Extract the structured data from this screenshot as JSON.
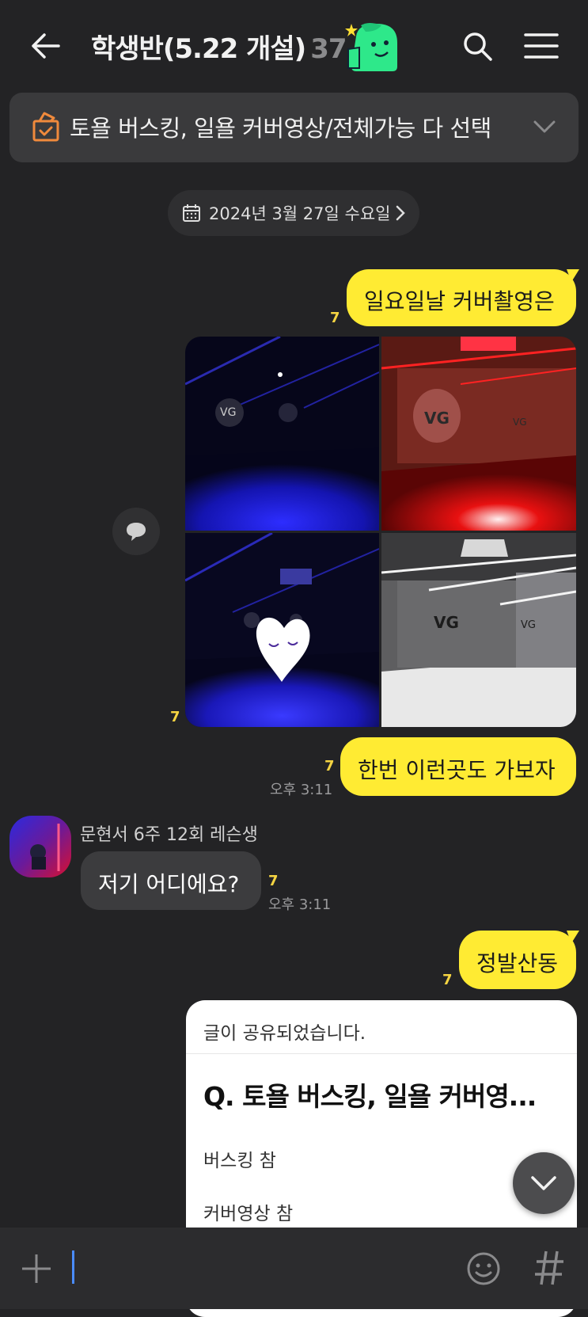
{
  "header": {
    "title": "학생반(5.22 개설)",
    "member_count": "37",
    "icons": [
      "back-arrow-icon",
      "search-icon",
      "menu-icon"
    ]
  },
  "notice": {
    "text": "토욜 버스킹, 일욜 커버영상/전체가능 다 선택"
  },
  "date_divider": "2024년 3월 27일 수요일",
  "messages": [
    {
      "from": "me",
      "text": "일요일날 커버촬영은",
      "unread": "7"
    },
    {
      "from": "me",
      "type": "photos",
      "unread": "7"
    },
    {
      "from": "me",
      "text": "한번 이런곳도 가보자",
      "unread": "7",
      "time": "오후 3:11"
    },
    {
      "from": "other",
      "sender": "문현서 6주 12회 레슨생",
      "text": "저기 어디에요?",
      "unread": "7",
      "time": "오후 3:11"
    },
    {
      "from": "me",
      "text": "정발산동",
      "unread": "7"
    }
  ],
  "share_card": {
    "header": "글이 공유되었습니다.",
    "question": "Q. 토욜 버스킹, 일욜 커버영...",
    "options": [
      "버스킹 참",
      "커버영상 참"
    ]
  },
  "colors": {
    "background": "#232325",
    "my_bubble": "#ffeb33",
    "other_bubble": "#3c3c3e",
    "unread": "#f5d442",
    "emoticon": "#2ee88a"
  }
}
